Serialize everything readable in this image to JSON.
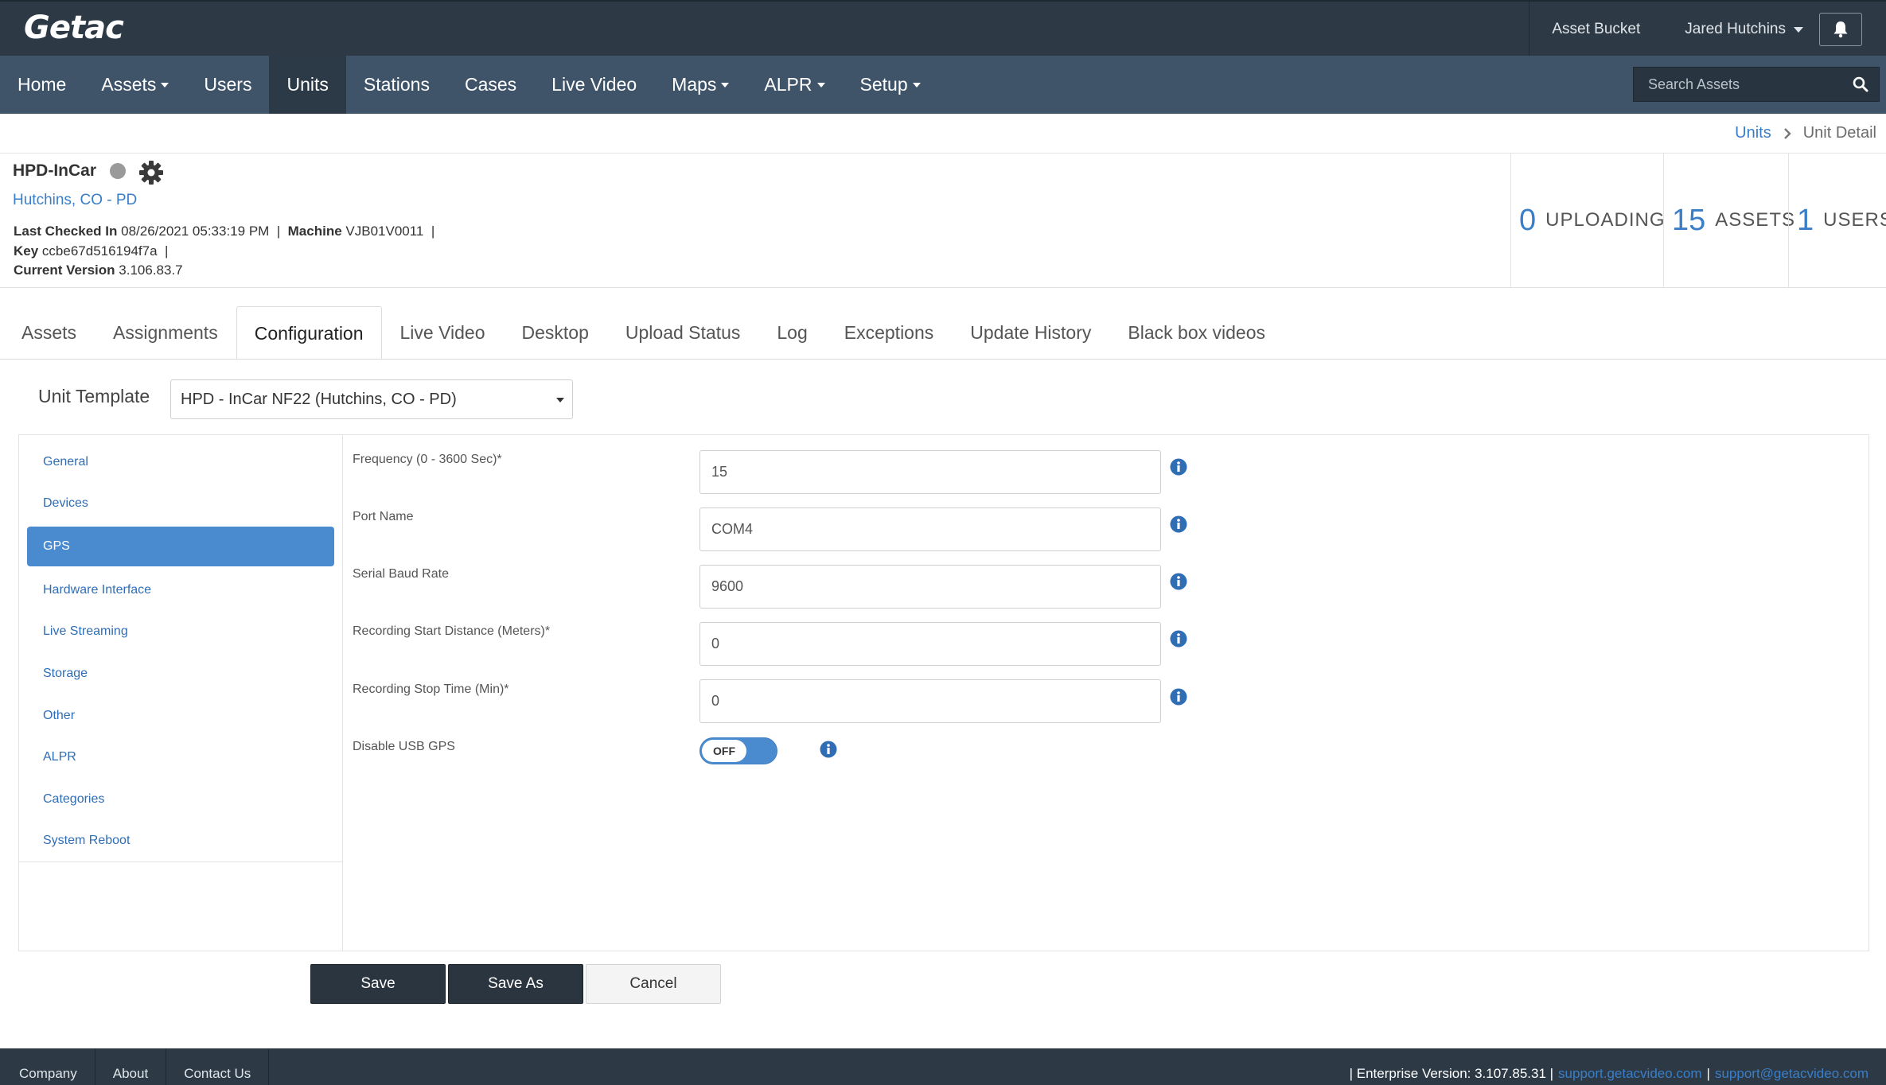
{
  "app": {
    "logo": "Getac"
  },
  "topbar": {
    "asset_bucket": "Asset Bucket",
    "user_name": "Jared Hutchins"
  },
  "nav": {
    "items": [
      {
        "label": "Home",
        "dropdown": false
      },
      {
        "label": "Assets",
        "dropdown": true
      },
      {
        "label": "Users",
        "dropdown": false
      },
      {
        "label": "Units",
        "dropdown": false,
        "active": true
      },
      {
        "label": "Stations",
        "dropdown": false
      },
      {
        "label": "Cases",
        "dropdown": false
      },
      {
        "label": "Live Video",
        "dropdown": false
      },
      {
        "label": "Maps",
        "dropdown": true
      },
      {
        "label": "ALPR",
        "dropdown": true
      },
      {
        "label": "Setup",
        "dropdown": true
      }
    ],
    "search_placeholder": "Search Assets"
  },
  "breadcrumb": {
    "parent": "Units",
    "current": "Unit Detail"
  },
  "unit": {
    "name": "HPD-InCar",
    "agency": "Hutchins, CO - PD",
    "last_checked_label": "Last Checked In",
    "last_checked_value": "08/26/2021 05:33:19 PM",
    "machine_label": "Machine",
    "machine_value": "VJB01V0011",
    "key_label": "Key",
    "key_value": "ccbe67d516194f7a",
    "version_label": "Current Version",
    "version_value": "3.106.83.7",
    "separator": "|"
  },
  "stats": [
    {
      "num": "0",
      "label": "UPLOADING"
    },
    {
      "num": "15",
      "label": "ASSETS"
    },
    {
      "num": "1",
      "label": "USERS"
    }
  ],
  "tabs": [
    {
      "label": "Assets"
    },
    {
      "label": "Assignments"
    },
    {
      "label": "Configuration",
      "active": true
    },
    {
      "label": "Live Video"
    },
    {
      "label": "Desktop"
    },
    {
      "label": "Upload Status"
    },
    {
      "label": "Log"
    },
    {
      "label": "Exceptions"
    },
    {
      "label": "Update History"
    },
    {
      "label": "Black box videos"
    }
  ],
  "template": {
    "label": "Unit Template",
    "selected": "HPD - InCar NF22 (Hutchins, CO - PD)"
  },
  "config_menu": [
    {
      "label": "General"
    },
    {
      "label": "Devices"
    },
    {
      "label": "GPS",
      "active": true
    },
    {
      "label": "Hardware Interface"
    },
    {
      "label": "Live Streaming"
    },
    {
      "label": "Storage"
    },
    {
      "label": "Other"
    },
    {
      "label": "ALPR"
    },
    {
      "label": "Categories"
    },
    {
      "label": "System Reboot"
    }
  ],
  "gps_fields": [
    {
      "label": "Frequency (0 - 3600 Sec)*",
      "value": "15"
    },
    {
      "label": "Port Name",
      "value": "COM4"
    },
    {
      "label": "Serial Baud Rate",
      "value": "9600"
    },
    {
      "label": "Recording Start Distance (Meters)*",
      "value": "0"
    },
    {
      "label": "Recording Stop Time (Min)*",
      "value": "0"
    }
  ],
  "usb_gps": {
    "label": "Disable USB GPS",
    "toggle_text": "OFF",
    "enabled": false
  },
  "buttons": {
    "save": "Save",
    "save_as": "Save As",
    "cancel": "Cancel"
  },
  "footer": {
    "links": [
      "Company",
      "About",
      "Contact Us"
    ],
    "version_text": "| Enterprise Version: 3.107.85.31 |",
    "support_site": "support.getacvideo.com",
    "support_sep": "|",
    "support_email": "support@getacvideo.com"
  },
  "colors": {
    "topbar": "#2d3a45",
    "navbar": "#3f5469",
    "accent": "#4a8bd0",
    "link": "#3a7ec7"
  }
}
